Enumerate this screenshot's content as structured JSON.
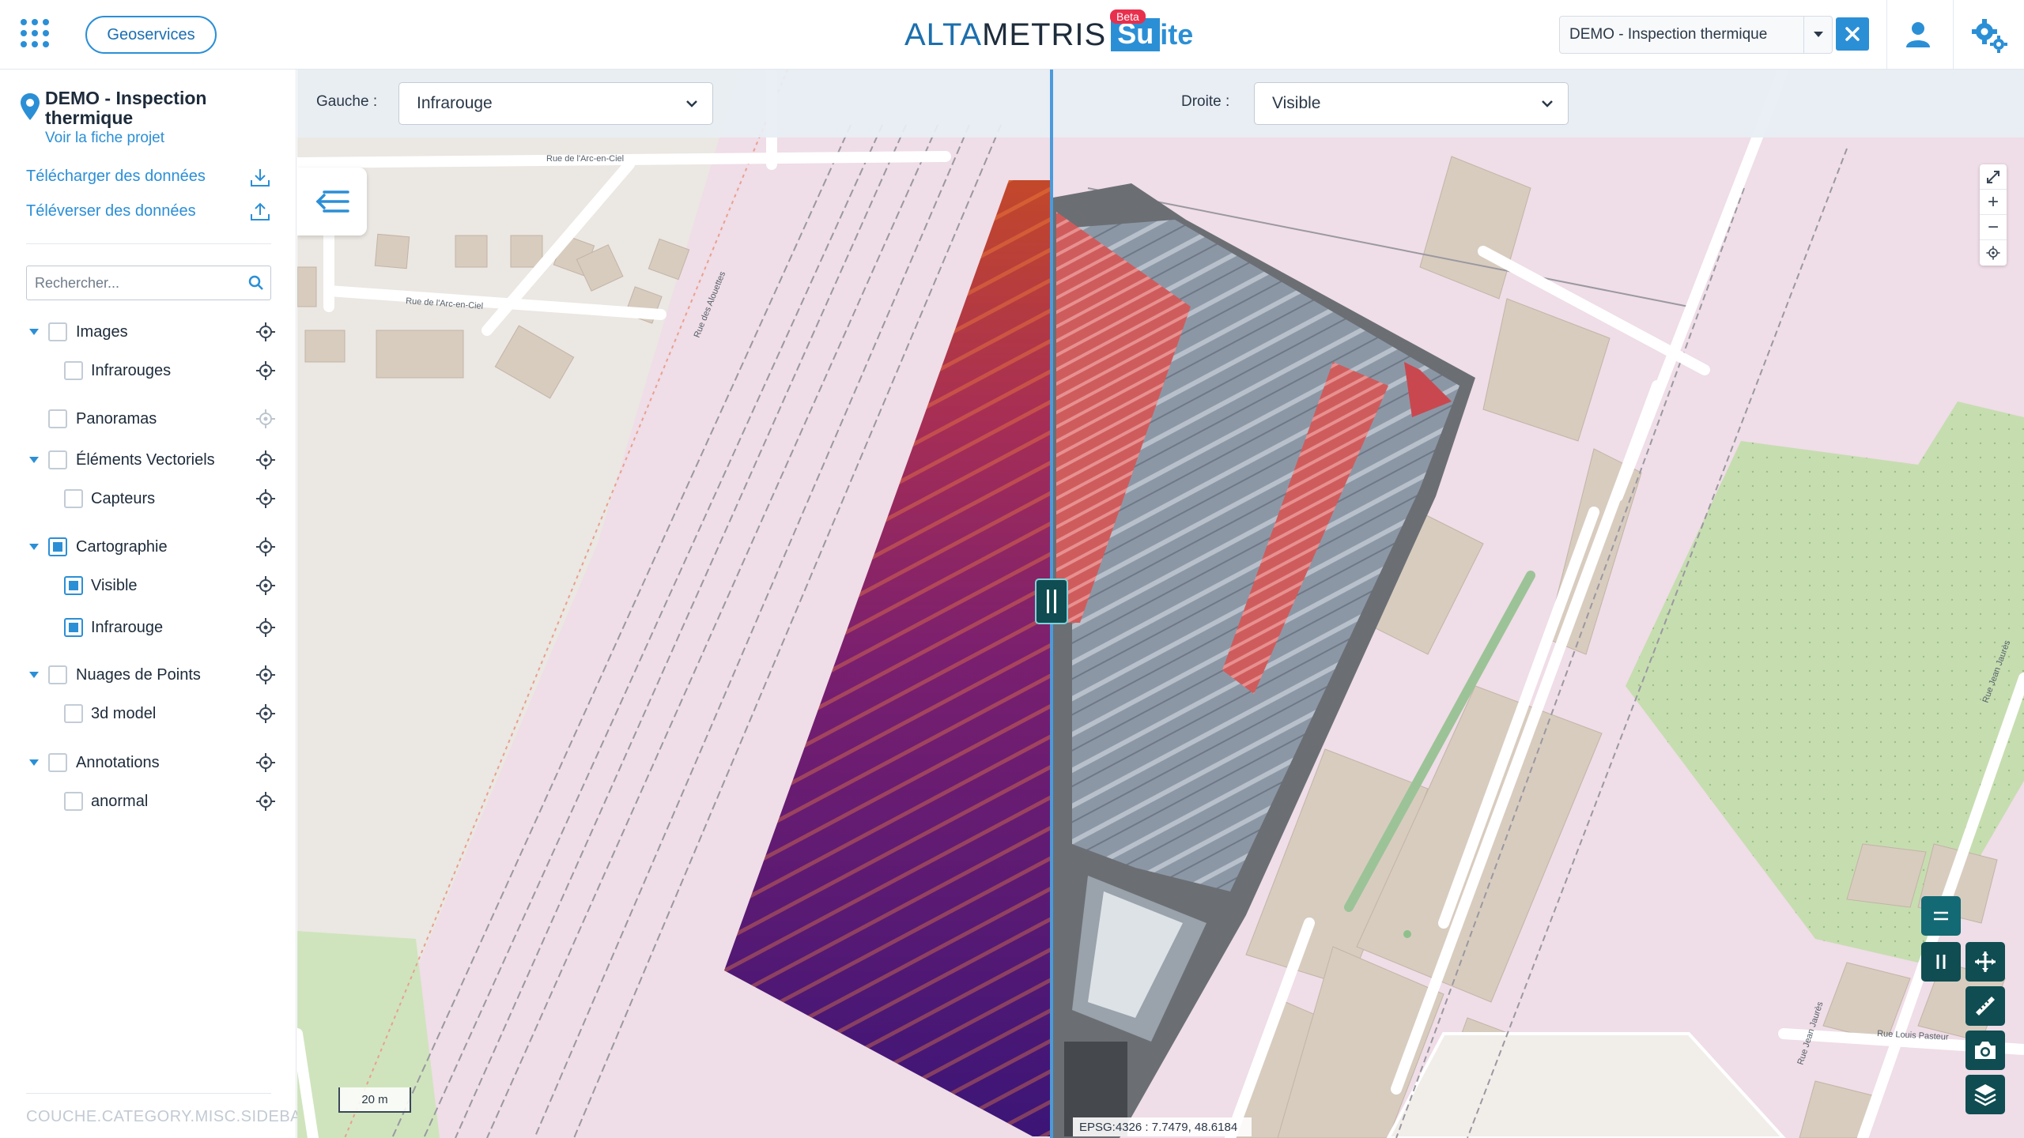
{
  "header": {
    "apps_icon": "apps-grid-icon",
    "geoservices_label": "Geoservices",
    "logo": {
      "alta": "ALTA",
      "metris": "METRIS",
      "suite_box": "Su",
      "suite_rest": "ite",
      "badge": "Beta"
    },
    "project_select_value": "DEMO - Inspection thermique",
    "clear_icon": "close-icon",
    "user_icon": "user-icon",
    "settings_icon": "gears-icon"
  },
  "sidebar": {
    "project_title": "DEMO - Inspection thermique",
    "project_link": "Voir la fiche projet",
    "download_label": "Télécharger des données",
    "upload_label": "Téléverser des données",
    "search_placeholder": "Rechercher...",
    "footer": "COUCHE.CATEGORY.MISC.SIDEBAR",
    "layers": [
      {
        "label": "Images",
        "checked": false,
        "expanded": true,
        "level": 0
      },
      {
        "label": "Infrarouges",
        "checked": false,
        "level": 1
      },
      {
        "label": "Panoramas",
        "checked": false,
        "level": 0,
        "locate_disabled": true
      },
      {
        "label": "Éléments Vectoriels",
        "checked": false,
        "expanded": true,
        "level": 0
      },
      {
        "label": "Capteurs",
        "checked": false,
        "level": 1
      },
      {
        "label": "Cartographie",
        "checked": true,
        "expanded": true,
        "level": 0
      },
      {
        "label": "Visible",
        "checked": true,
        "level": 1
      },
      {
        "label": "Infrarouge",
        "checked": true,
        "level": 1
      },
      {
        "label": "Nuages de Points",
        "checked": false,
        "expanded": true,
        "level": 0
      },
      {
        "label": "3d model",
        "checked": false,
        "level": 1
      },
      {
        "label": "Annotations",
        "checked": false,
        "expanded": true,
        "level": 0
      },
      {
        "label": "anormal",
        "checked": false,
        "level": 1
      }
    ]
  },
  "map": {
    "left_label": "Gauche :",
    "left_value": "Infrarouge",
    "right_label": "Droite :",
    "right_value": "Visible",
    "scale_label": "20 m",
    "coords": "EPSG:4326 : 7.7479, 48.6184",
    "street_labels": [
      "Rue de l'Arc-en-Ciel",
      "Rue de l'Arc-en-Ciel",
      "Rue des Alouettes",
      "Rue Louis Pasteur",
      "Rue Jean Jaurès",
      "Rue Jean Jaurès"
    ],
    "zoom": {
      "expand_icon": "fullscreen-icon",
      "in": "+",
      "out": "−",
      "locate_icon": "locate-icon"
    },
    "tools": [
      "equals-icon",
      "pause-icon",
      "move-icon",
      "ruler-icon",
      "camera-icon",
      "layers-icon"
    ]
  },
  "colors": {
    "accent": "#2b8fd6",
    "dark_teal": "#0f4d52",
    "alert": "#e8304d"
  }
}
